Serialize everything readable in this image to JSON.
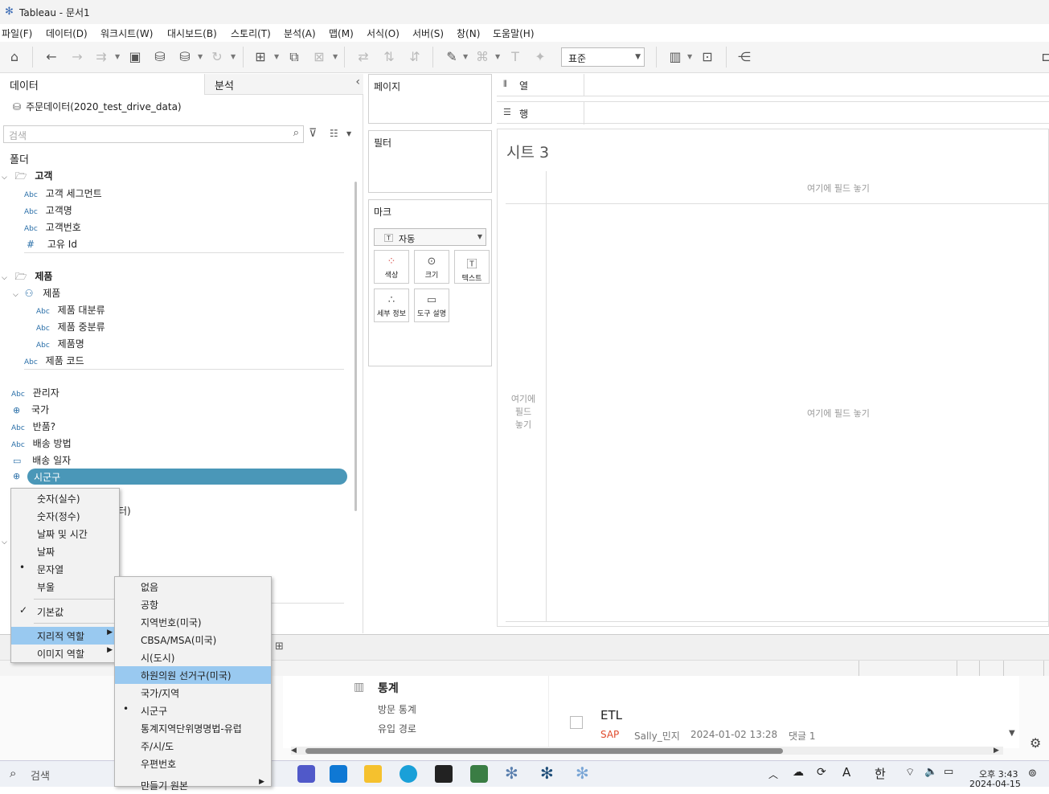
{
  "window": {
    "title": "Tableau - 문서1"
  },
  "menubar": [
    "파일(F)",
    "데이터(D)",
    "워크시트(W)",
    "대시보드(B)",
    "스토리(T)",
    "분석(A)",
    "맵(M)",
    "서식(O)",
    "서버(S)",
    "창(N)",
    "도움말(H)"
  ],
  "toolbar": {
    "fit_select": "표준"
  },
  "left_pane": {
    "tab_data": "데이터",
    "tab_analysis": "분석",
    "datasource": "주문데이터(2020_test_drive_data)",
    "search_placeholder": "검색",
    "folders_label": "폴더",
    "folder_customer": "고객",
    "customer_fields": [
      {
        "type": "Abc",
        "name": "고객 세그먼트"
      },
      {
        "type": "Abc",
        "name": "고객명"
      },
      {
        "type": "Abc",
        "name": "고객번호"
      },
      {
        "type": "#",
        "name": "고유 Id"
      }
    ],
    "folder_product": "제품",
    "hierarchy_product": "제품",
    "product_hier_fields": [
      {
        "type": "Abc",
        "name": "제품 대분류"
      },
      {
        "type": "Abc",
        "name": "제품 중분류"
      },
      {
        "type": "Abc",
        "name": "제품명"
      }
    ],
    "product_code": {
      "type": "Abc",
      "name": "제품 코드"
    },
    "loose_fields": [
      {
        "type": "Abc",
        "name": "관리자"
      },
      {
        "type": "globe",
        "name": "국가"
      },
      {
        "type": "Abc",
        "name": "반품?"
      },
      {
        "type": "Abc",
        "name": "배송 방법"
      },
      {
        "type": "calendar",
        "name": "배송 일자"
      }
    ],
    "selected_field": "시군구",
    "partial_text": "터)"
  },
  "shelves": {
    "pages": "페이지",
    "filters": "필터",
    "marks": "마크",
    "marks_type": "자동",
    "mark_buttons": [
      "색상",
      "크기",
      "텍스트",
      "세부 정보",
      "도구 설명"
    ],
    "columns": "열",
    "rows": "행"
  },
  "canvas": {
    "sheet_title": "시트 3",
    "drop_top": "여기에 필드 놓기",
    "drop_center": "여기에 필드 놓기",
    "drop_left": "여기에\n필드\n놓기"
  },
  "context_menu": {
    "items": [
      "숫자(실수)",
      "숫자(정수)",
      "날짜 및 시간",
      "날짜",
      "문자열",
      "부울"
    ],
    "checked_type": "문자열",
    "default": "기본값",
    "geo_role": "지리적 역할",
    "image_role": "이미지 역할"
  },
  "geo_submenu": {
    "items": [
      "없음",
      "공항",
      "지역번호(미국)",
      "CBSA/MSA(미국)",
      "시(도시)",
      "하원의원 선거구(미국)",
      "국가/지역",
      "시군구",
      "통계지역단위명명법-유럽",
      "주/시/도",
      "우편번호",
      "만들기 원본"
    ],
    "highlighted": "하원의원 선거구(미국)",
    "checked": "시군구"
  },
  "browser": {
    "stats_title": "통계",
    "stats_links": [
      "방문 통계",
      "유입 경로"
    ],
    "post_title": "ETL",
    "post_tag": "SAP",
    "post_author": "Sally_민지",
    "post_date": "2024-01-02 13:28",
    "post_comments": "댓글 1"
  },
  "taskbar": {
    "search": "검색",
    "ime1": "A",
    "ime2": "한",
    "time": "오후 3:43",
    "date": "2024-04-15"
  },
  "colors": {
    "selected_pill": "#4a97b8",
    "menu_highlight": "#99c9f0"
  }
}
